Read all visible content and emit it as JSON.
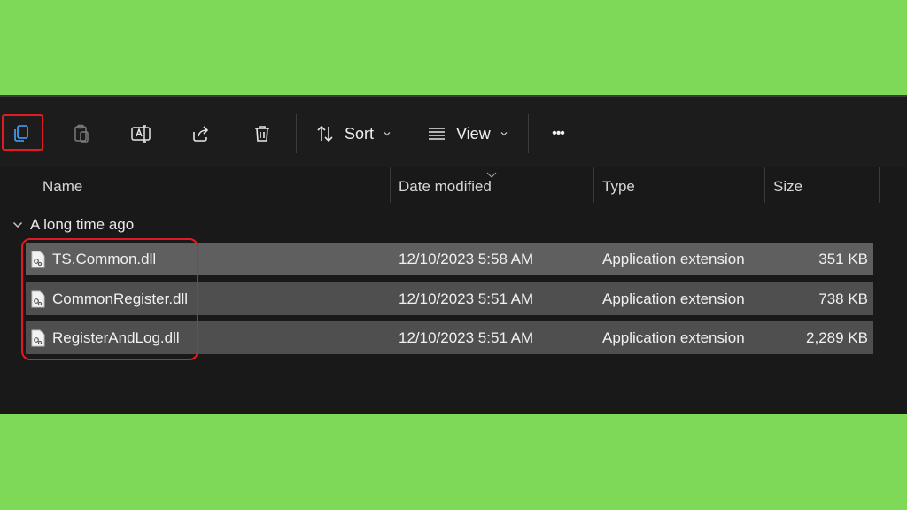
{
  "toolbar": {
    "copy_icon": "copy-icon",
    "paste_icon": "paste-icon",
    "rename_icon": "rename-icon",
    "share_icon": "share-icon",
    "delete_icon": "delete-icon",
    "sort_label": "Sort",
    "view_label": "View",
    "more_label": "•••"
  },
  "columns": {
    "name": "Name",
    "date": "Date modified",
    "type": "Type",
    "size": "Size"
  },
  "group": {
    "label": "A long time ago"
  },
  "files": [
    {
      "name": "TS.Common.dll",
      "date": "12/10/2023 5:58 AM",
      "type": "Application extension",
      "size": "351 KB"
    },
    {
      "name": "CommonRegister.dll",
      "date": "12/10/2023 5:51 AM",
      "type": "Application extension",
      "size": "738 KB"
    },
    {
      "name": "RegisterAndLog.dll",
      "date": "12/10/2023 5:51 AM",
      "type": "Application extension",
      "size": "2,289 KB"
    }
  ],
  "colors": {
    "background": "#7ed957",
    "window": "#191919",
    "highlight": "#e01b24",
    "selected_row": "#5f5f5f"
  }
}
